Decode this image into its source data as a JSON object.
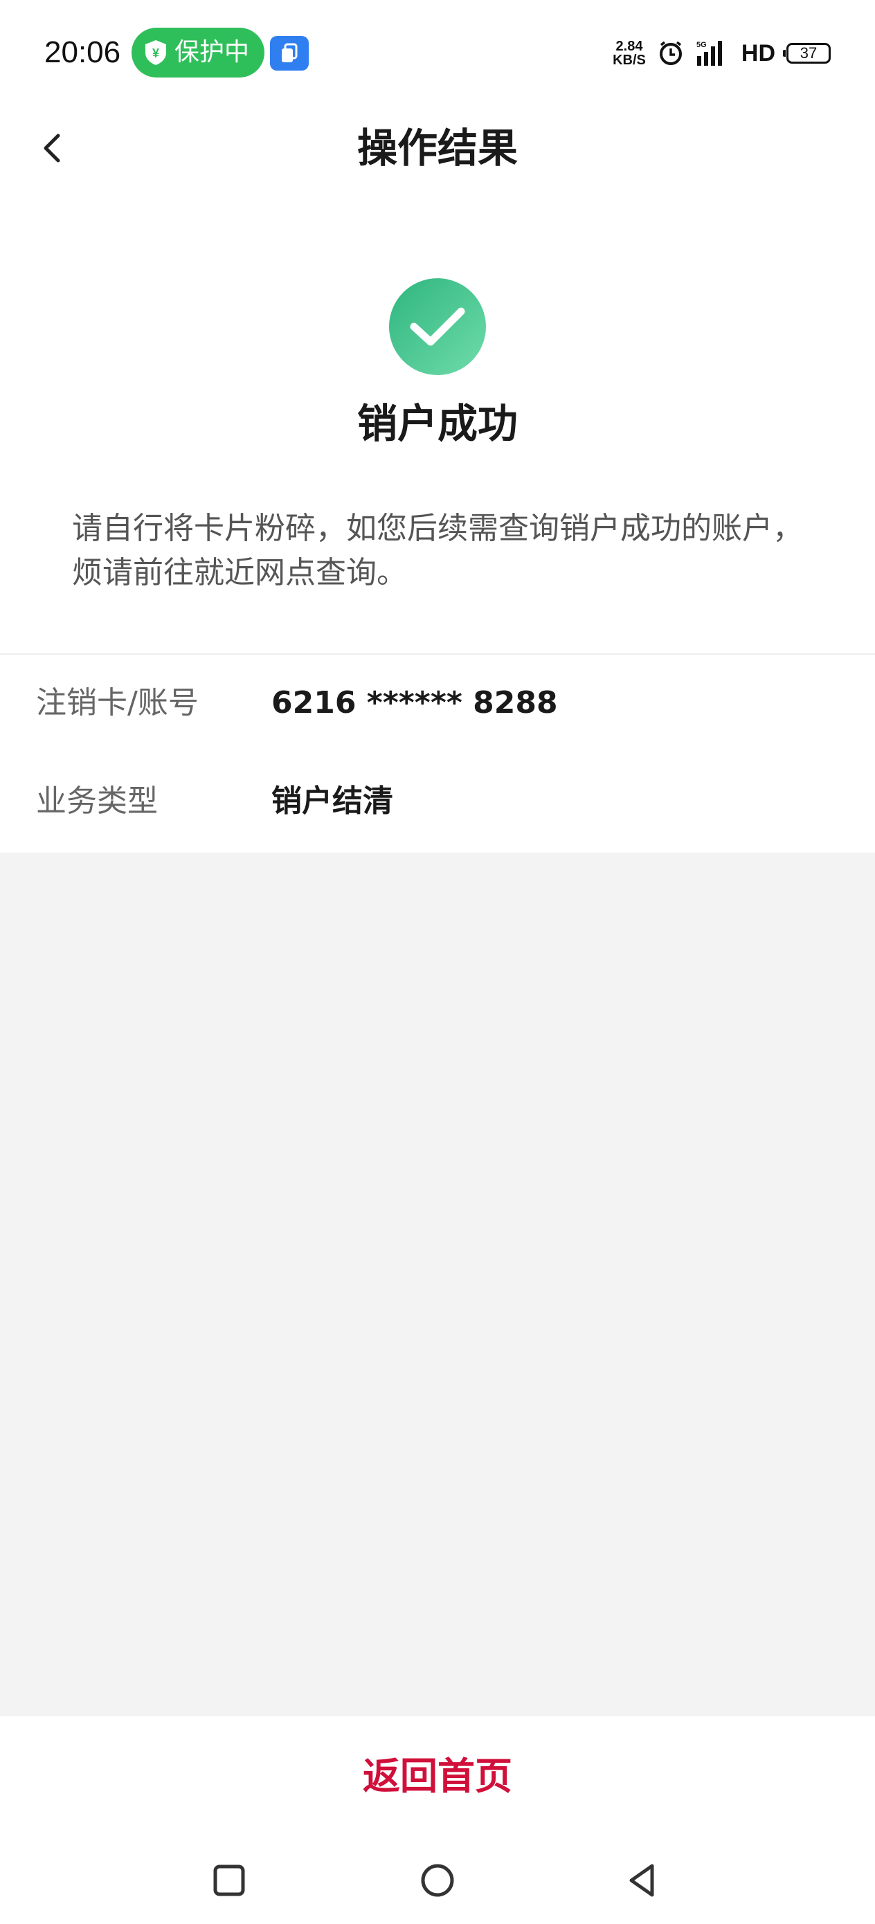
{
  "status_bar": {
    "time": "20:06",
    "protect_label": "保护中",
    "net_speed_value": "2.84",
    "net_speed_unit": "KB/S",
    "hd_label": "HD",
    "battery_level": "37",
    "signal_label": "5G"
  },
  "nav": {
    "title": "操作结果"
  },
  "result": {
    "title": "销户成功",
    "description": "请自行将卡片粉碎，如您后续需查询销户成功的账户，烦请前往就近网点查询。"
  },
  "details": [
    {
      "label": "注销卡/账号",
      "value": "6216 ****** 8288"
    },
    {
      "label": "业务类型",
      "value": "销户结清"
    }
  ],
  "actions": {
    "home_label": "返回首页"
  },
  "colors": {
    "accent_red": "#d0103a",
    "success_green": "#3cc28c",
    "protect_green": "#2fbf5a"
  }
}
